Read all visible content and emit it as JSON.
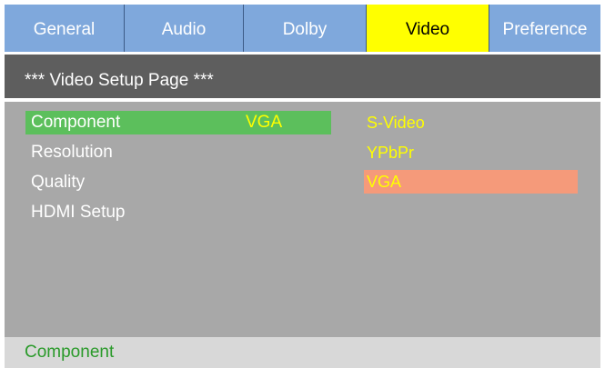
{
  "tabs": [
    {
      "label": "General"
    },
    {
      "label": "Audio"
    },
    {
      "label": "Dolby"
    },
    {
      "label": "Video",
      "active": true
    },
    {
      "label": "Preference"
    }
  ],
  "page_title": "*** Video Setup Page ***",
  "menu": {
    "items": [
      {
        "label": "Component",
        "value": "VGA",
        "selected": true
      },
      {
        "label": "Resolution"
      },
      {
        "label": "Quality"
      },
      {
        "label": "HDMI Setup"
      }
    ]
  },
  "options": [
    {
      "label": "S-Video"
    },
    {
      "label": "YPbPr"
    },
    {
      "label": "VGA",
      "highlighted": true
    }
  ],
  "status": {
    "text": "Component"
  },
  "colors": {
    "tab_bar": "#7fa8dc",
    "active_tab": "#ffff00",
    "header": "#5e5e5e",
    "panel": "#a8a8a8",
    "selected_item": "#5cbf5c",
    "option_text": "#ffff00",
    "highlighted_option": "#f59a7a",
    "status_bar": "#d8d8d8",
    "status_text": "#2a9a2a"
  }
}
